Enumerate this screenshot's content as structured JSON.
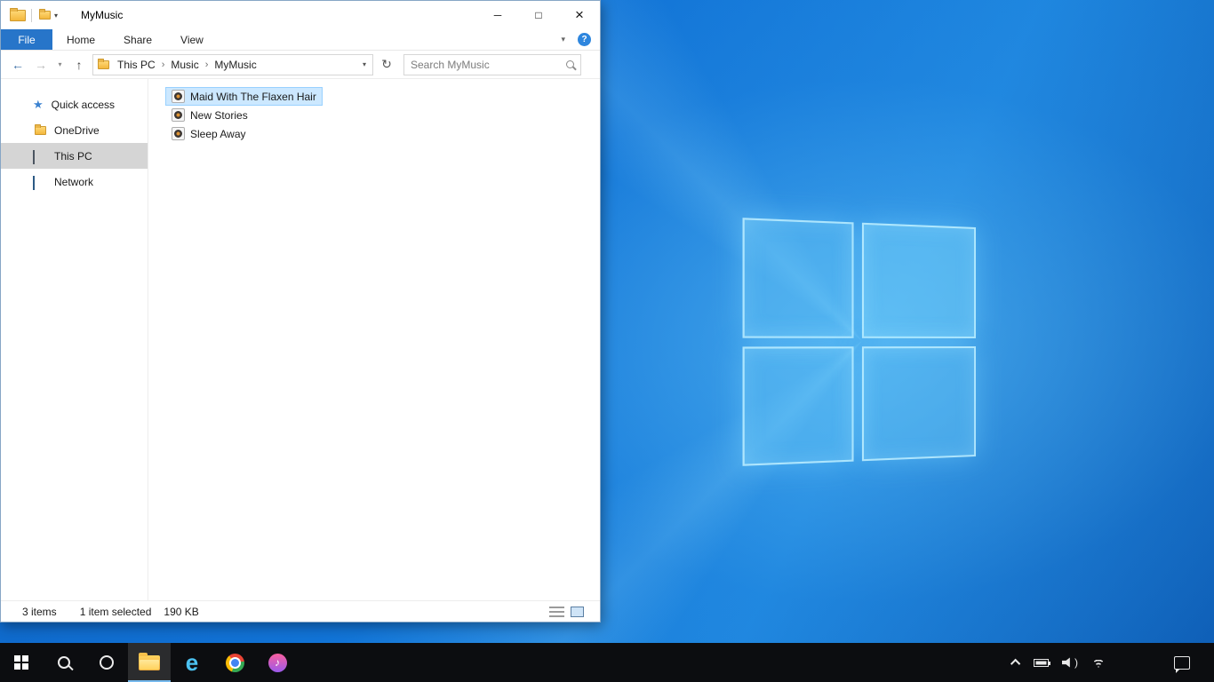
{
  "colors": {
    "accent_blue": "#2775c9",
    "selection_bg": "#cce8ff",
    "selection_border": "#99d1ff",
    "sidebar_selected": "#d5d5d5",
    "taskbar_bg": "#0c0d10",
    "wallpaper_blues": [
      "#0e63c4",
      "#1173d6",
      "#1e86df",
      "#0d5cb4"
    ]
  },
  "window": {
    "title": "MyMusic",
    "titlebar_buttons": {
      "minimize": "─",
      "maximize": "□",
      "close": "×"
    },
    "ribbon": {
      "file_tab": "File",
      "tabs": [
        "Home",
        "Share",
        "View"
      ],
      "collapse_glyph": "▾",
      "help_glyph": "?"
    },
    "navbar": {
      "back_glyph": "←",
      "forward_glyph": "→",
      "history_caret": "▾",
      "up_glyph": "↑",
      "breadcrumb": [
        "This PC",
        "Music",
        "MyMusic"
      ],
      "separator": "›",
      "address_caret": "▾",
      "refresh_glyph": "↻",
      "search_placeholder": "Search MyMusic"
    },
    "sidebar": {
      "items": [
        {
          "label": "Quick access",
          "icon": "quick-access-star"
        },
        {
          "label": "OneDrive",
          "icon": "onedrive-folder"
        },
        {
          "label": "This PC",
          "icon": "this-pc-monitor",
          "selected": true
        },
        {
          "label": "Network",
          "icon": "network-monitor"
        }
      ]
    },
    "files": [
      {
        "name": "Maid With The Flaxen Hair",
        "icon": "media-file",
        "selected": true
      },
      {
        "name": "New Stories",
        "icon": "media-file",
        "selected": false
      },
      {
        "name": "Sleep Away",
        "icon": "media-file",
        "selected": false
      }
    ],
    "statusbar": {
      "items_count": "3 items",
      "selection_count": "1 item selected",
      "selection_size": "190 KB"
    }
  },
  "taskbar": {
    "apps": [
      "start",
      "search",
      "cortana",
      "file-explorer",
      "internet-explorer",
      "chrome",
      "itunes"
    ],
    "active_app": "file-explorer",
    "ie_glyph": "e",
    "itunes_note_glyph": "♪",
    "tray_icons": [
      "hidden-icons-chevron",
      "battery",
      "volume",
      "wifi"
    ],
    "action_center_icon": "action-center-bubble"
  }
}
